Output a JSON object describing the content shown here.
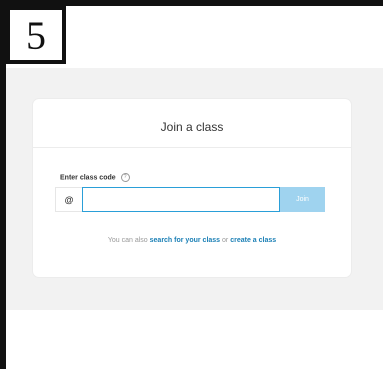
{
  "step": {
    "number": "5"
  },
  "card": {
    "title": "Join a class",
    "code_label": "Enter class code",
    "help_icon": "?",
    "prefix": "@",
    "input_value": "",
    "input_placeholder": "",
    "join_label": "Join",
    "footer": {
      "prefix_text": "You can also ",
      "search_link": "search for your class",
      "middle_text": " or ",
      "create_link": "create a class"
    }
  },
  "colors": {
    "accent": "#2a9fd8",
    "join_button": "#9fd3ef",
    "link": "#1a7fb5",
    "page_bg": "#f2f2f2"
  }
}
